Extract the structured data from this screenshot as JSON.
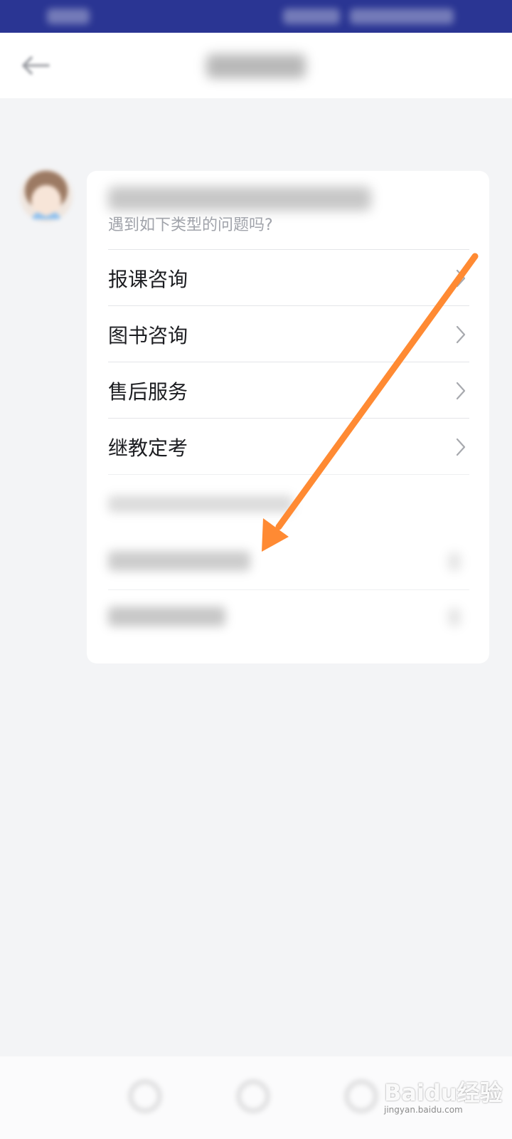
{
  "card": {
    "subtitle": "遇到如下类型的问题吗?",
    "menu_items": [
      {
        "label": "报课咨询"
      },
      {
        "label": "图书咨询"
      },
      {
        "label": "售后服务"
      },
      {
        "label": "继教定考"
      }
    ]
  },
  "watermark": {
    "main": "Baidu经验",
    "sub": "jingyan.baidu.com"
  },
  "colors": {
    "status_bar": "#2a3593",
    "annotation_arrow": "#ff8a33",
    "page_background": "#f3f4f6"
  },
  "icons": {
    "back": "back-arrow-icon",
    "chevron": "chevron-right-icon"
  }
}
